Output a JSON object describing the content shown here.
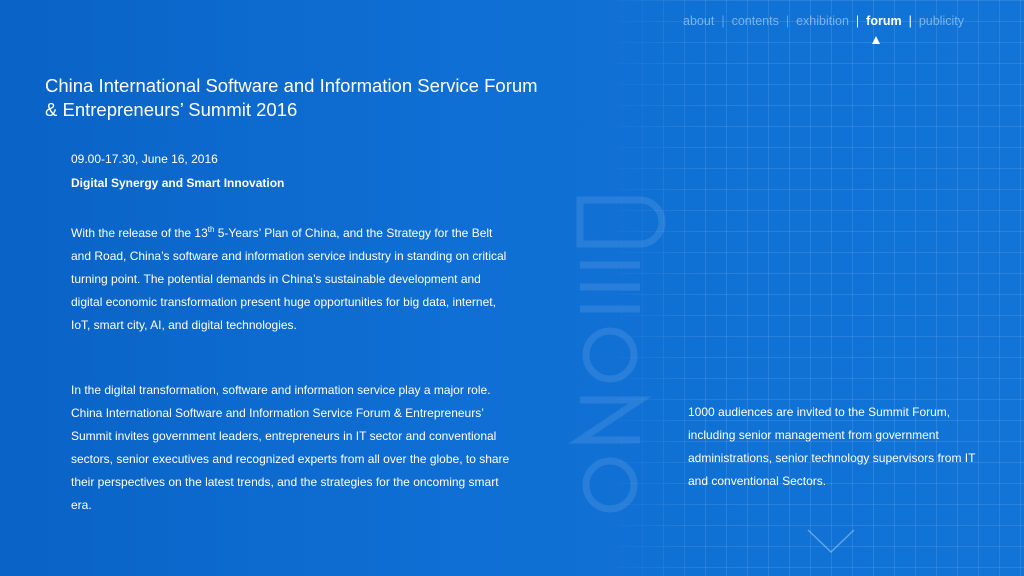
{
  "nav": {
    "items": [
      "about",
      "contents",
      "exhibition",
      "forum",
      "publicity"
    ],
    "active": "forum"
  },
  "title": {
    "line1": "China International Software and Information Service Forum",
    "line2": "& Entrepreneurs’ Summit 2016"
  },
  "event": {
    "datetime": "09.00-17.30, June 16, 2016",
    "theme": "Digital Synergy and Smart Innovation"
  },
  "paragraphs": {
    "p1_before_sup": "With the release of the 13",
    "p1_sup": "th",
    "p1_after_sup": " 5-Years’ Plan of China, and the Strategy for the Belt and Road, China’s software and information service industry in standing on critical turning point.   The potential demands in China’s sustainable development and digital economic transformation present huge opportunities for big data, internet, IoT, smart city, AI, and digital technologies.",
    "p2": "In the digital transformation, software and information service play a major role.  China International Software and Information Service Forum & Entrepreneurs’ Summit invites government leaders, entrepreneurs in IT sector and conventional sectors, senior executives and recognized experts from all over the globe, to share their perspectives on the latest trends, and the strategies for the oncoming smart era."
  },
  "audience": {
    "text": "1000 audiences are invited to the Summit Forum, including senior management from government administrations, senior technology supervisors from IT and conventional Sectors."
  },
  "colors": {
    "background": "#0f6fd4",
    "text": "#ffffff",
    "nav_inactive": "#7fb0e8"
  }
}
